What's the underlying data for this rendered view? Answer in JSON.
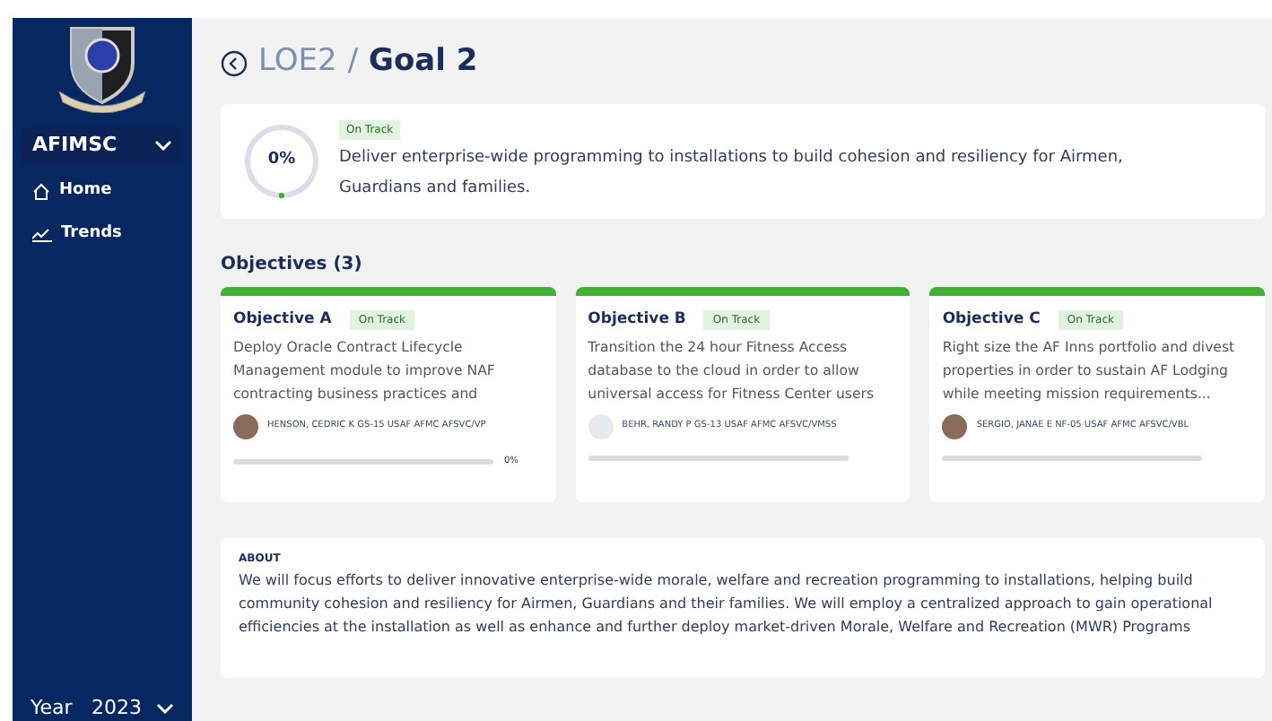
{
  "sidebar": {
    "org": "AFIMSC",
    "items": [
      {
        "label": "Home"
      },
      {
        "label": "Trends"
      }
    ],
    "year": {
      "label": "Year",
      "value": "2023"
    }
  },
  "breadcrumb": {
    "parent": "LOE2",
    "separator": "/",
    "current": "Goal 2"
  },
  "goal": {
    "progress_text": "0%",
    "level": 0,
    "status": "On Track",
    "description": "Deliver enterprise-wide programming to installations to build cohesion and resiliency for Airmen, Guardians and families."
  },
  "objectives_heading": "Objectives (3)",
  "objectives": [
    {
      "title": "Objective A",
      "status": "On Track",
      "description": "Deploy Oracle Contract Lifecycle Management module to improve NAF contracting business practices and",
      "owner": "HENSON, CEDRIC K GS-15 USAF AFMC AFSVC/VP",
      "kind": "photo",
      "level": 0,
      "reading": "0%"
    },
    {
      "title": "Objective B",
      "status": "On Track",
      "description": "Transition the 24 hour Fitness Access database to the cloud in order to allow universal access for Fitness Center users",
      "owner": "BEHR, RANDY P GS-13 USAF AFMC AFSVC/VMSS",
      "kind": "blank",
      "level": 0
    },
    {
      "title": "Objective C",
      "status": "On Track",
      "description": "Right size the AF Inns portfolio and divest properties in order to sustain AF Lodging while meeting mission requirements...",
      "owner": "SERGIO, JANAE E NF-05 USAF AFMC AFSVC/VBL",
      "kind": "photo",
      "level": 0
    }
  ],
  "about": {
    "heading": "ABOUT",
    "text": "We will focus efforts to deliver innovative enterprise-wide morale, welfare and recreation programming to installations, helping build community cohesion and resiliency for Airmen, Guardians and their families. We will employ a centralized approach to gain operational efficiencies at the installation as well as enhance and further deploy market-driven Morale, Welfare and Recreation (MWR) Programs"
  }
}
